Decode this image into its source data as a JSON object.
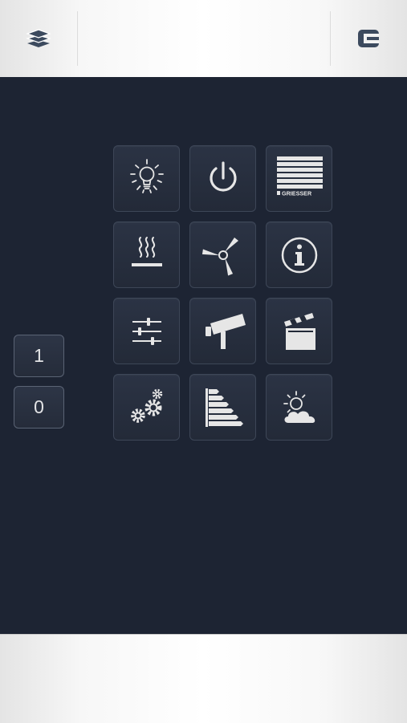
{
  "colors": {
    "background": "#1d2433",
    "icon": "#e6e6e6",
    "topbar_icon": "#3c4a5e",
    "tile_border": "#3d4657"
  },
  "topbar": {
    "left_icon": "layers-icon",
    "right_icon": "logo-c-icon"
  },
  "side_buttons": {
    "one_label": "1",
    "zero_label": "0"
  },
  "tiles": [
    {
      "icon": "light-bulb-icon"
    },
    {
      "icon": "power-icon"
    },
    {
      "icon": "blinds-griesser-icon",
      "label": "GRIESSER"
    },
    {
      "icon": "heating-icon"
    },
    {
      "icon": "fan-icon"
    },
    {
      "icon": "info-icon"
    },
    {
      "icon": "sliders-icon"
    },
    {
      "icon": "camera-icon"
    },
    {
      "icon": "clapperboard-icon"
    },
    {
      "icon": "gears-icon"
    },
    {
      "icon": "energy-rating-icon"
    },
    {
      "icon": "weather-sun-cloud-icon"
    }
  ]
}
